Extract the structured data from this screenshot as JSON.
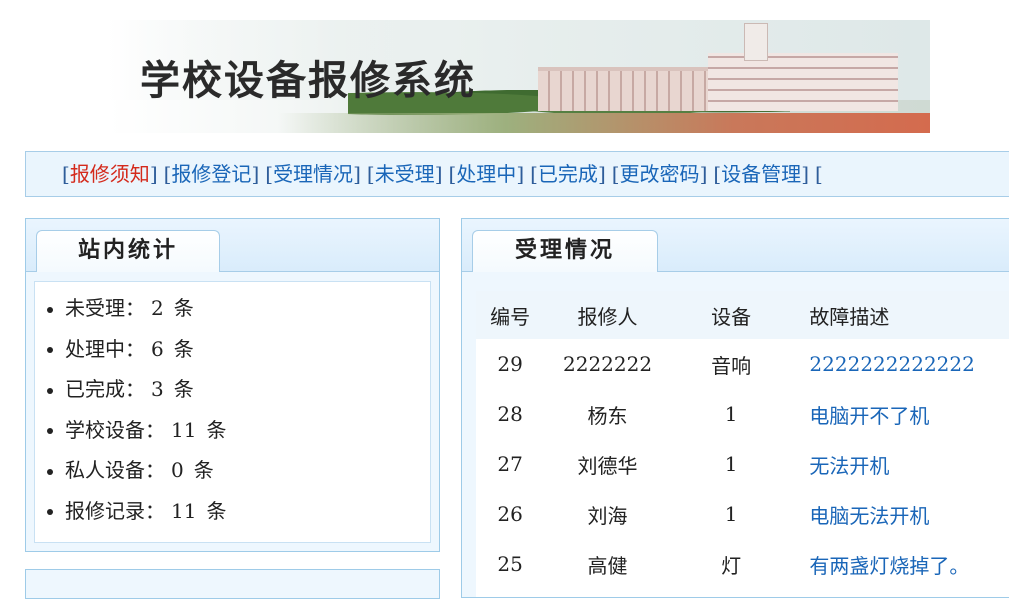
{
  "banner": {
    "title": "学校设备报修系统"
  },
  "nav": {
    "items": [
      {
        "label": "报修须知",
        "active": true
      },
      {
        "label": "报修登记"
      },
      {
        "label": "受理情况"
      },
      {
        "label": "未受理"
      },
      {
        "label": "处理中"
      },
      {
        "label": "已完成"
      },
      {
        "label": "更改密码"
      },
      {
        "label": "设备管理"
      }
    ]
  },
  "stats": {
    "title": "站内统计",
    "items": [
      {
        "label": "未受理：",
        "value": "2",
        "unit": "条"
      },
      {
        "label": "处理中：",
        "value": "6",
        "unit": "条"
      },
      {
        "label": "已完成：",
        "value": "3",
        "unit": "条"
      },
      {
        "label": "学校设备：",
        "value": "11",
        "unit": "条"
      },
      {
        "label": "私人设备：",
        "value": "0",
        "unit": "条"
      },
      {
        "label": "报修记录：",
        "value": "11",
        "unit": "条"
      }
    ]
  },
  "requests": {
    "title": "受理情况",
    "columns": [
      "编号",
      "报修人",
      "设备",
      "故障描述"
    ],
    "rows": [
      {
        "id": "29",
        "reporter": "2222222",
        "device": "音响",
        "desc": "2222222222222"
      },
      {
        "id": "28",
        "reporter": "杨东",
        "device": "1",
        "desc": "电脑开不了机"
      },
      {
        "id": "27",
        "reporter": "刘德华",
        "device": "1",
        "desc": "无法开机"
      },
      {
        "id": "26",
        "reporter": "刘海",
        "device": "1",
        "desc": "电脑无法开机"
      },
      {
        "id": "25",
        "reporter": "高健",
        "device": "灯",
        "desc": "有两盏灯烧掉了。"
      }
    ]
  },
  "colors": {
    "link": "#1a66b8",
    "active": "#d42a1c",
    "border": "#a7cde8",
    "panel_bg": "#eef7fe"
  }
}
